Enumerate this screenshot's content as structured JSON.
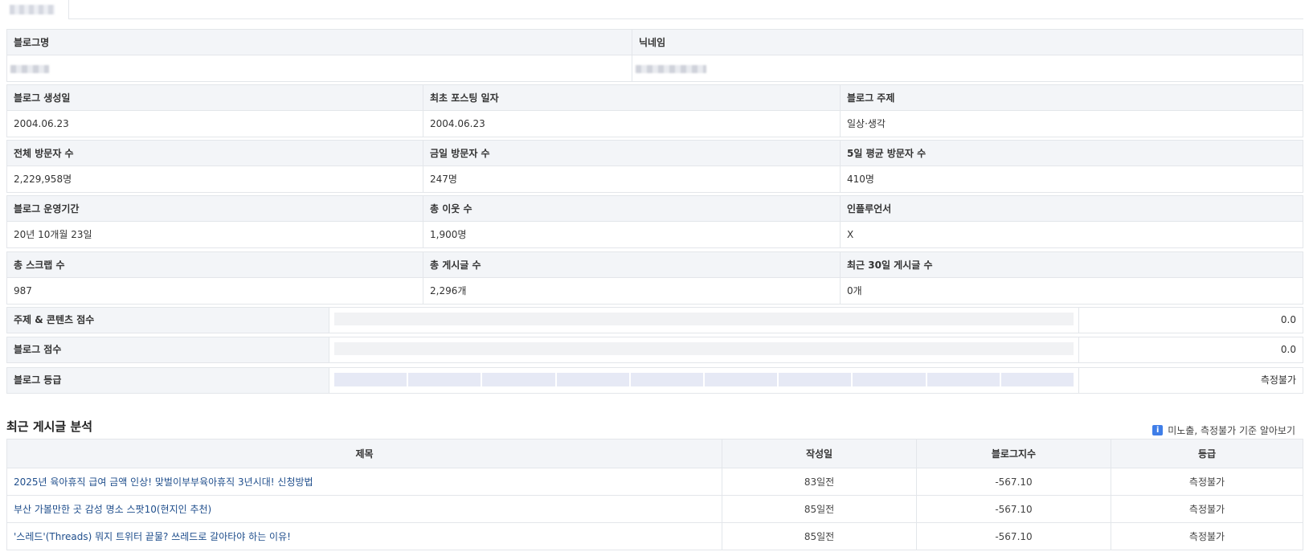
{
  "info_rows": [
    [
      {
        "label": "블로그명",
        "value": ""
      },
      {
        "label": "닉네임",
        "value": ""
      }
    ],
    [
      {
        "label": "블로그 생성일",
        "value": "2004.06.23"
      },
      {
        "label": "최초 포스팅 일자",
        "value": "2004.06.23"
      },
      {
        "label": "블로그 주제",
        "value": "일상·생각"
      }
    ],
    [
      {
        "label": "전체 방문자 수",
        "value": "2,229,958명"
      },
      {
        "label": "금일 방문자 수",
        "value": "247명"
      },
      {
        "label": "5일 평균 방문자 수",
        "value": "410명"
      }
    ],
    [
      {
        "label": "블로그 운영기간",
        "value": "20년 10개월 23일"
      },
      {
        "label": "총 이웃 수",
        "value": "1,900명"
      },
      {
        "label": "인플루언서",
        "value": "X"
      }
    ],
    [
      {
        "label": "총 스크랩 수",
        "value": "987"
      },
      {
        "label": "총 게시글 수",
        "value": "2,296개"
      },
      {
        "label": "최근 30일 게시글 수",
        "value": "0개"
      }
    ]
  ],
  "scores": [
    {
      "label": "주제 & 콘텐츠 점수",
      "value": "0.0",
      "fraction": 0
    },
    {
      "label": "블로그 점수",
      "value": "0.0",
      "fraction": 0
    },
    {
      "label": "블로그 등급",
      "value": "측정불가",
      "segments": 10
    }
  ],
  "recent": {
    "title": "최근 게시글 분석",
    "help_text": "미노출, 측정불가 기준 알아보기",
    "help_icon": "info-icon",
    "columns": [
      "제목",
      "작성일",
      "블로그지수",
      "등급"
    ],
    "rows": [
      {
        "title": "2025년 육아휴직 급여 금액 인상! 맞벌이부부육아휴직 3년시대! 신청방법",
        "date": "83일전",
        "index": "-567.10",
        "grade": "측정불가"
      },
      {
        "title": "부산 가볼만한 곳 감성 명소 스팟10(현지인 추천)",
        "date": "85일전",
        "index": "-567.10",
        "grade": "측정불가"
      },
      {
        "title": "'스레드'(Threads) 뭐지 트위터 끝물? 쓰레드로 갈아타야 하는 이유!",
        "date": "85일전",
        "index": "-567.10",
        "grade": "측정불가"
      }
    ]
  }
}
